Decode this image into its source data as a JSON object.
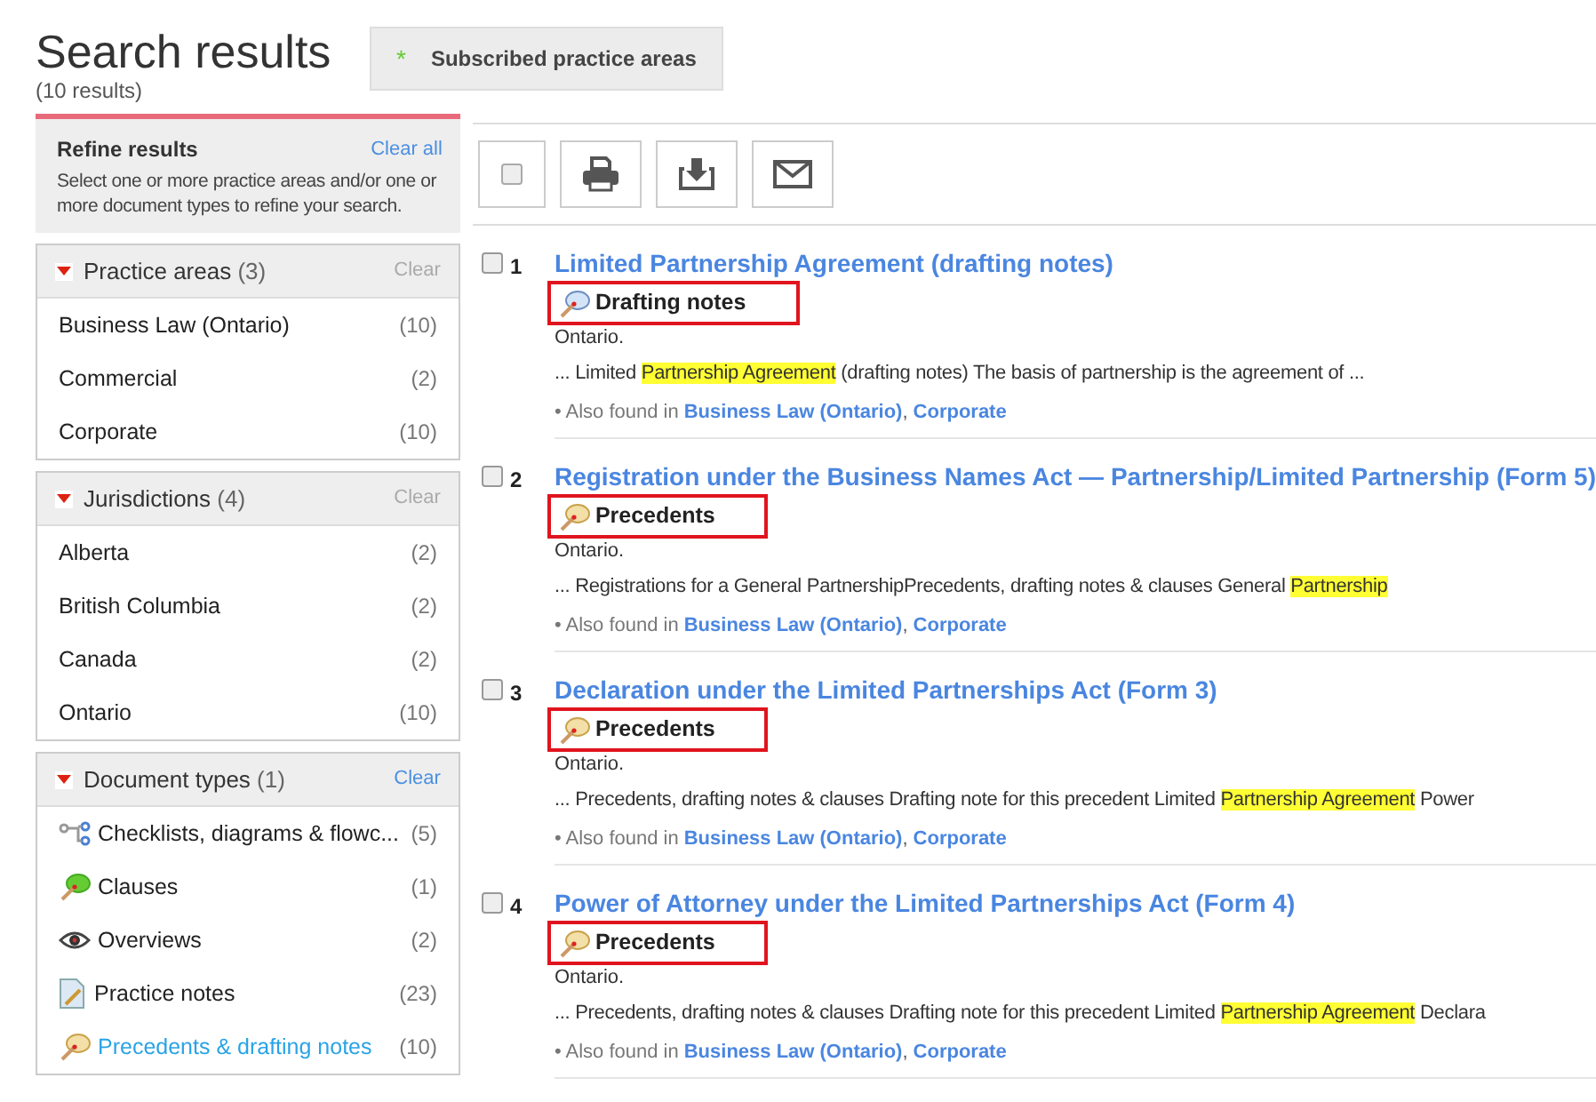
{
  "header": {
    "title": "Search results",
    "count": "(10 results)",
    "tab": {
      "marker": "*",
      "label": "Subscribed practice areas",
      "selected": true
    }
  },
  "refine": {
    "title": "Refine results",
    "clear_all": "Clear all",
    "hint": "Select one or more practice areas and/or one or more document types to refine your search."
  },
  "facets": [
    {
      "title": "Practice areas",
      "count": "(3)",
      "clear": "Clear",
      "clear_enabled": false,
      "expanded": true,
      "items": [
        {
          "label": "Business Law (Ontario)",
          "count": "(10)",
          "selected": false
        },
        {
          "label": "Commercial",
          "count": "(2)",
          "selected": false
        },
        {
          "label": "Corporate",
          "count": "(10)",
          "selected": false
        }
      ]
    },
    {
      "title": "Jurisdictions",
      "count": "(4)",
      "clear": "Clear",
      "clear_enabled": false,
      "expanded": true,
      "items": [
        {
          "label": "Alberta",
          "count": "(2)",
          "selected": false
        },
        {
          "label": "British Columbia",
          "count": "(2)",
          "selected": false
        },
        {
          "label": "Canada",
          "count": "(2)",
          "selected": false
        },
        {
          "label": "Ontario",
          "count": "(10)",
          "selected": false
        }
      ]
    },
    {
      "title": "Document types",
      "count": "(1)",
      "clear": "Clear",
      "clear_enabled": true,
      "expanded": true,
      "items": [
        {
          "kind": "flowchart",
          "label": "Checklists, diagrams & flowc...",
          "count": "(5)",
          "selected": false
        },
        {
          "kind": "clause",
          "label": "Clauses",
          "count": "(1)",
          "selected": false
        },
        {
          "kind": "overview",
          "label": "Overviews",
          "count": "(2)",
          "selected": false
        },
        {
          "kind": "practice-note",
          "label": "Practice notes",
          "count": "(23)",
          "selected": false
        },
        {
          "kind": "precedent",
          "label": "Precedents & drafting notes",
          "count": "(10)",
          "selected": true
        }
      ]
    }
  ],
  "toolbar": {
    "select_all_checked": false
  },
  "results": [
    {
      "number": "1",
      "checked": false,
      "title": "Limited Partnership Agreement (drafting notes)",
      "type": {
        "kind": "drafting-note",
        "label": "Drafting notes",
        "outlined": true
      },
      "jurisdiction": "Ontario.",
      "snippet": [
        {
          "text": "... Limited ",
          "highlighted": false
        },
        {
          "text": "Partnership Agreement",
          "highlighted": true
        },
        {
          "text": " (drafting notes) The basis of partnership is the agreement of  ...",
          "highlighted": false
        }
      ],
      "also_found_label": "• Also found in",
      "also_found": [
        "Business Law (Ontario)",
        "Corporate"
      ],
      "also_found_separator": ","
    },
    {
      "number": "2",
      "checked": false,
      "title": "Registration under the Business Names Act — Partnership/Limited Partnership (Form 5)",
      "type": {
        "kind": "precedent",
        "label": "Precedents",
        "outlined": true
      },
      "jurisdiction": "Ontario.",
      "snippet": [
        {
          "text": "...  Registrations for a General PartnershipPrecedents, drafting notes & clauses General ",
          "highlighted": false
        },
        {
          "text": "Partnership",
          "highlighted": true
        }
      ],
      "also_found_label": "• Also found in",
      "also_found": [
        "Business Law (Ontario)",
        "Corporate"
      ],
      "also_found_separator": ","
    },
    {
      "number": "3",
      "checked": false,
      "title": "Declaration under the Limited Partnerships Act (Form 3)",
      "type": {
        "kind": "precedent",
        "label": "Precedents",
        "outlined": true
      },
      "jurisdiction": "Ontario.",
      "snippet": [
        {
          "text": "... Precedents, drafting notes & clauses Drafting note for this precedent Limited ",
          "highlighted": false
        },
        {
          "text": "Partnership Agreement",
          "highlighted": true
        },
        {
          "text": " Power",
          "highlighted": false
        }
      ],
      "also_found_label": "• Also found in",
      "also_found": [
        "Business Law (Ontario)",
        "Corporate"
      ],
      "also_found_separator": ","
    },
    {
      "number": "4",
      "checked": false,
      "title": "Power of Attorney under the Limited Partnerships Act (Form 4)",
      "type": {
        "kind": "precedent",
        "label": "Precedents",
        "outlined": true
      },
      "jurisdiction": "Ontario.",
      "snippet": [
        {
          "text": "... Precedents, drafting notes & clauses Drafting note for this precedent Limited ",
          "highlighted": false
        },
        {
          "text": "Partnership Agreement",
          "highlighted": true
        },
        {
          "text": " Declara",
          "highlighted": false
        }
      ],
      "also_found_label": "• Also found in",
      "also_found": [
        "Business Law (Ontario)",
        "Corporate"
      ],
      "also_found_separator": ","
    }
  ]
}
